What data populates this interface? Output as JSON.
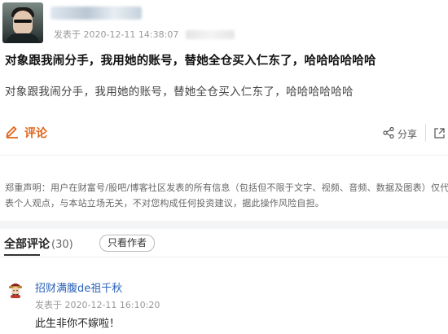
{
  "post": {
    "meta": "发表于 2020-12-11 14:38:07",
    "title": "对象跟我闹分手，我用她的账号，替她全仓买入仁东了，哈哈哈哈哈哈",
    "body": "对象跟我闹分手，我用她的账号，替她全仓买入仁东了，哈哈哈哈哈哈"
  },
  "actions": {
    "comment_label": "评论",
    "share_label": "分享"
  },
  "disclaimer": "郑重声明：用户在财富号/股吧/博客社区发表的所有信息（包括但不限于文字、视频、音频、数据及图表）仅代表个人观点，与本站立场无关，不对您构成任何投资建议，据此操作风险自担。",
  "comments_section": {
    "tab_label": "全部评论",
    "count": "(30)",
    "author_only_label": "只看作者"
  },
  "comments": [
    {
      "user": "招财满腹de祖千秋",
      "time": "发表于 2020-12-11 16:10:20",
      "text": "此生非你不嫁啦！"
    }
  ],
  "colors": {
    "accent": "#e0651b",
    "link": "#2b62b8",
    "muted": "#999999"
  },
  "icons": {
    "comment": "pencil-icon",
    "share": "share-icon",
    "export": "external-link-icon",
    "commenter_avatar": "fortune-god-avatar"
  }
}
